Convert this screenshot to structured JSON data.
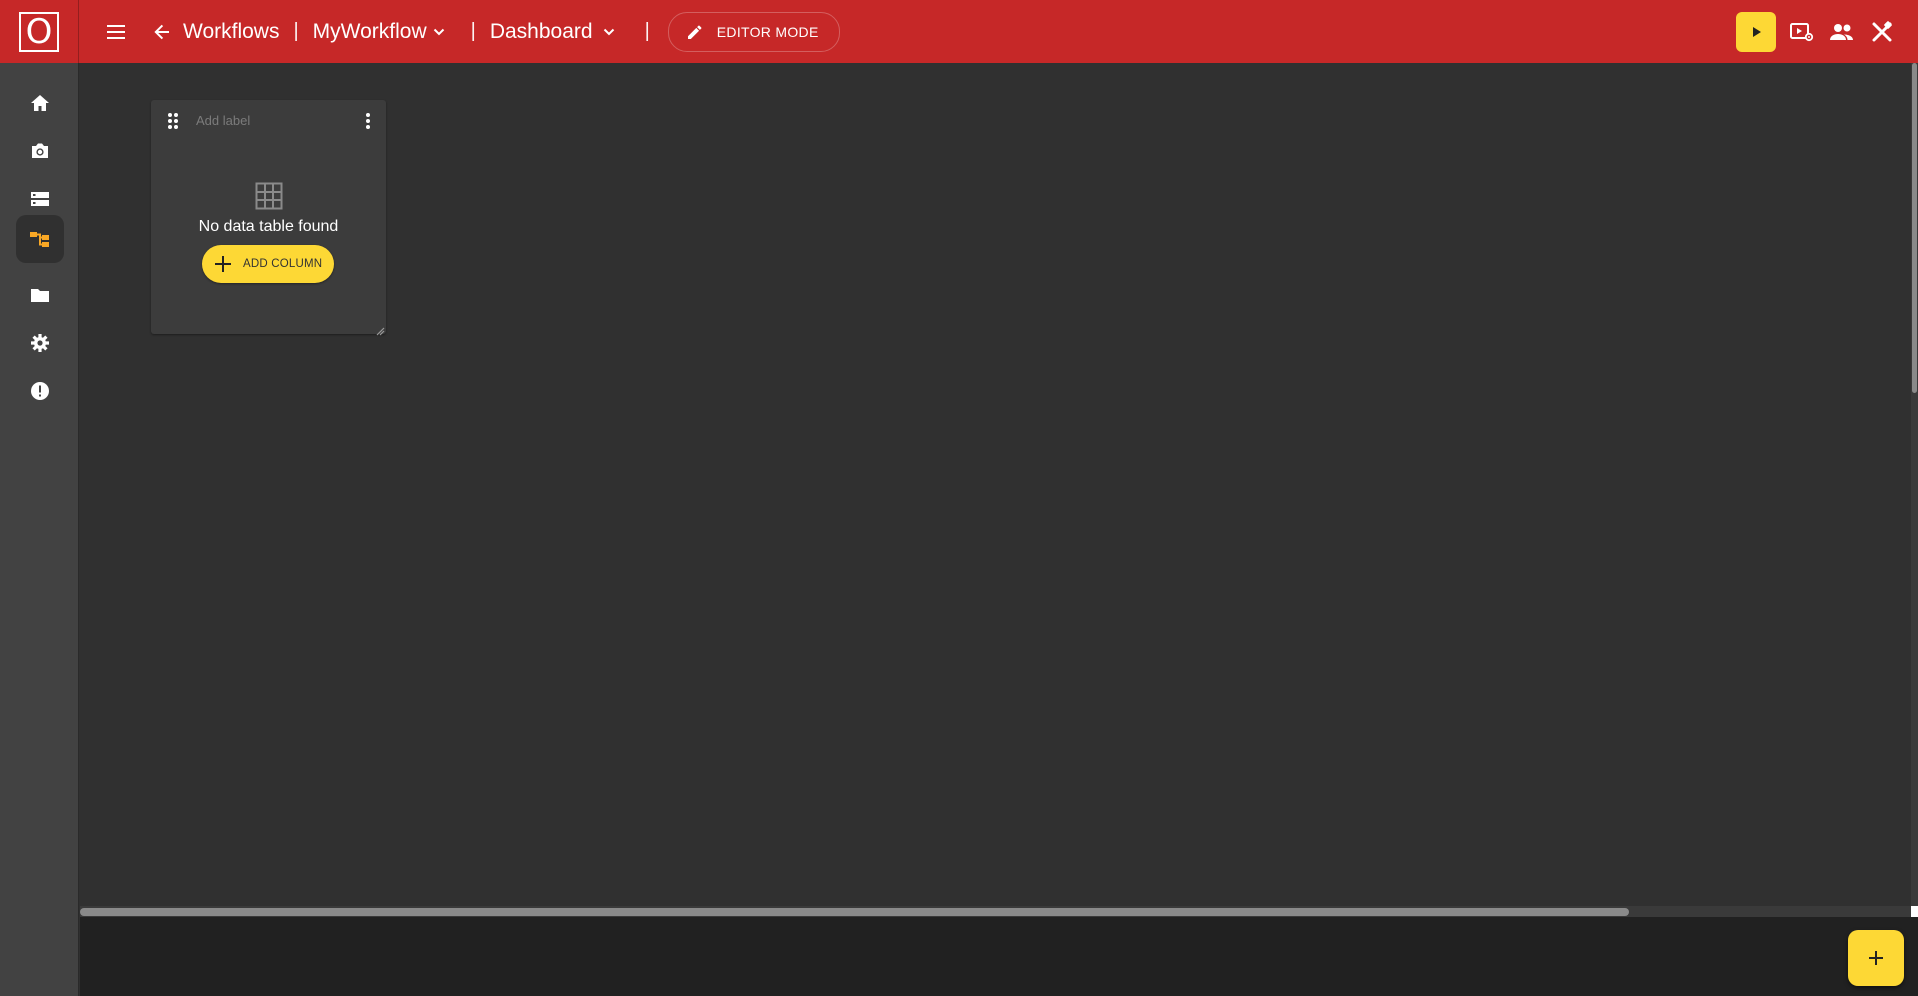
{
  "app": {
    "logo_letter": "O",
    "accent_color": "#c62828",
    "highlight_color": "#fdd835"
  },
  "topbar": {
    "menu_icon": "hamburger-menu-icon",
    "back_icon": "arrow-left-icon",
    "breadcrumb_root": "Workflows",
    "workflow_name": "MyWorkflow",
    "view_name": "Dashboard",
    "editor_mode_label": "EDITOR MODE",
    "right_icons": [
      "play-icon",
      "preview-settings-icon",
      "people-icon",
      "tools-close-icon"
    ]
  },
  "sidebar": {
    "items": [
      {
        "icon": "home-icon",
        "active": false
      },
      {
        "icon": "camera-icon",
        "active": false
      },
      {
        "icon": "storage-icon",
        "active": false
      },
      {
        "icon": "workflow-tree-icon",
        "active": true
      },
      {
        "icon": "folder-icon",
        "active": false
      },
      {
        "icon": "settings-gear-icon",
        "active": false
      },
      {
        "icon": "alert-circle-icon",
        "active": false
      }
    ]
  },
  "widget": {
    "label_placeholder": "Add label",
    "empty_icon": "table-grid-icon",
    "empty_message": "No data table found",
    "add_column_label": "ADD COLUMN"
  },
  "fab": {
    "icon": "plus-icon"
  }
}
